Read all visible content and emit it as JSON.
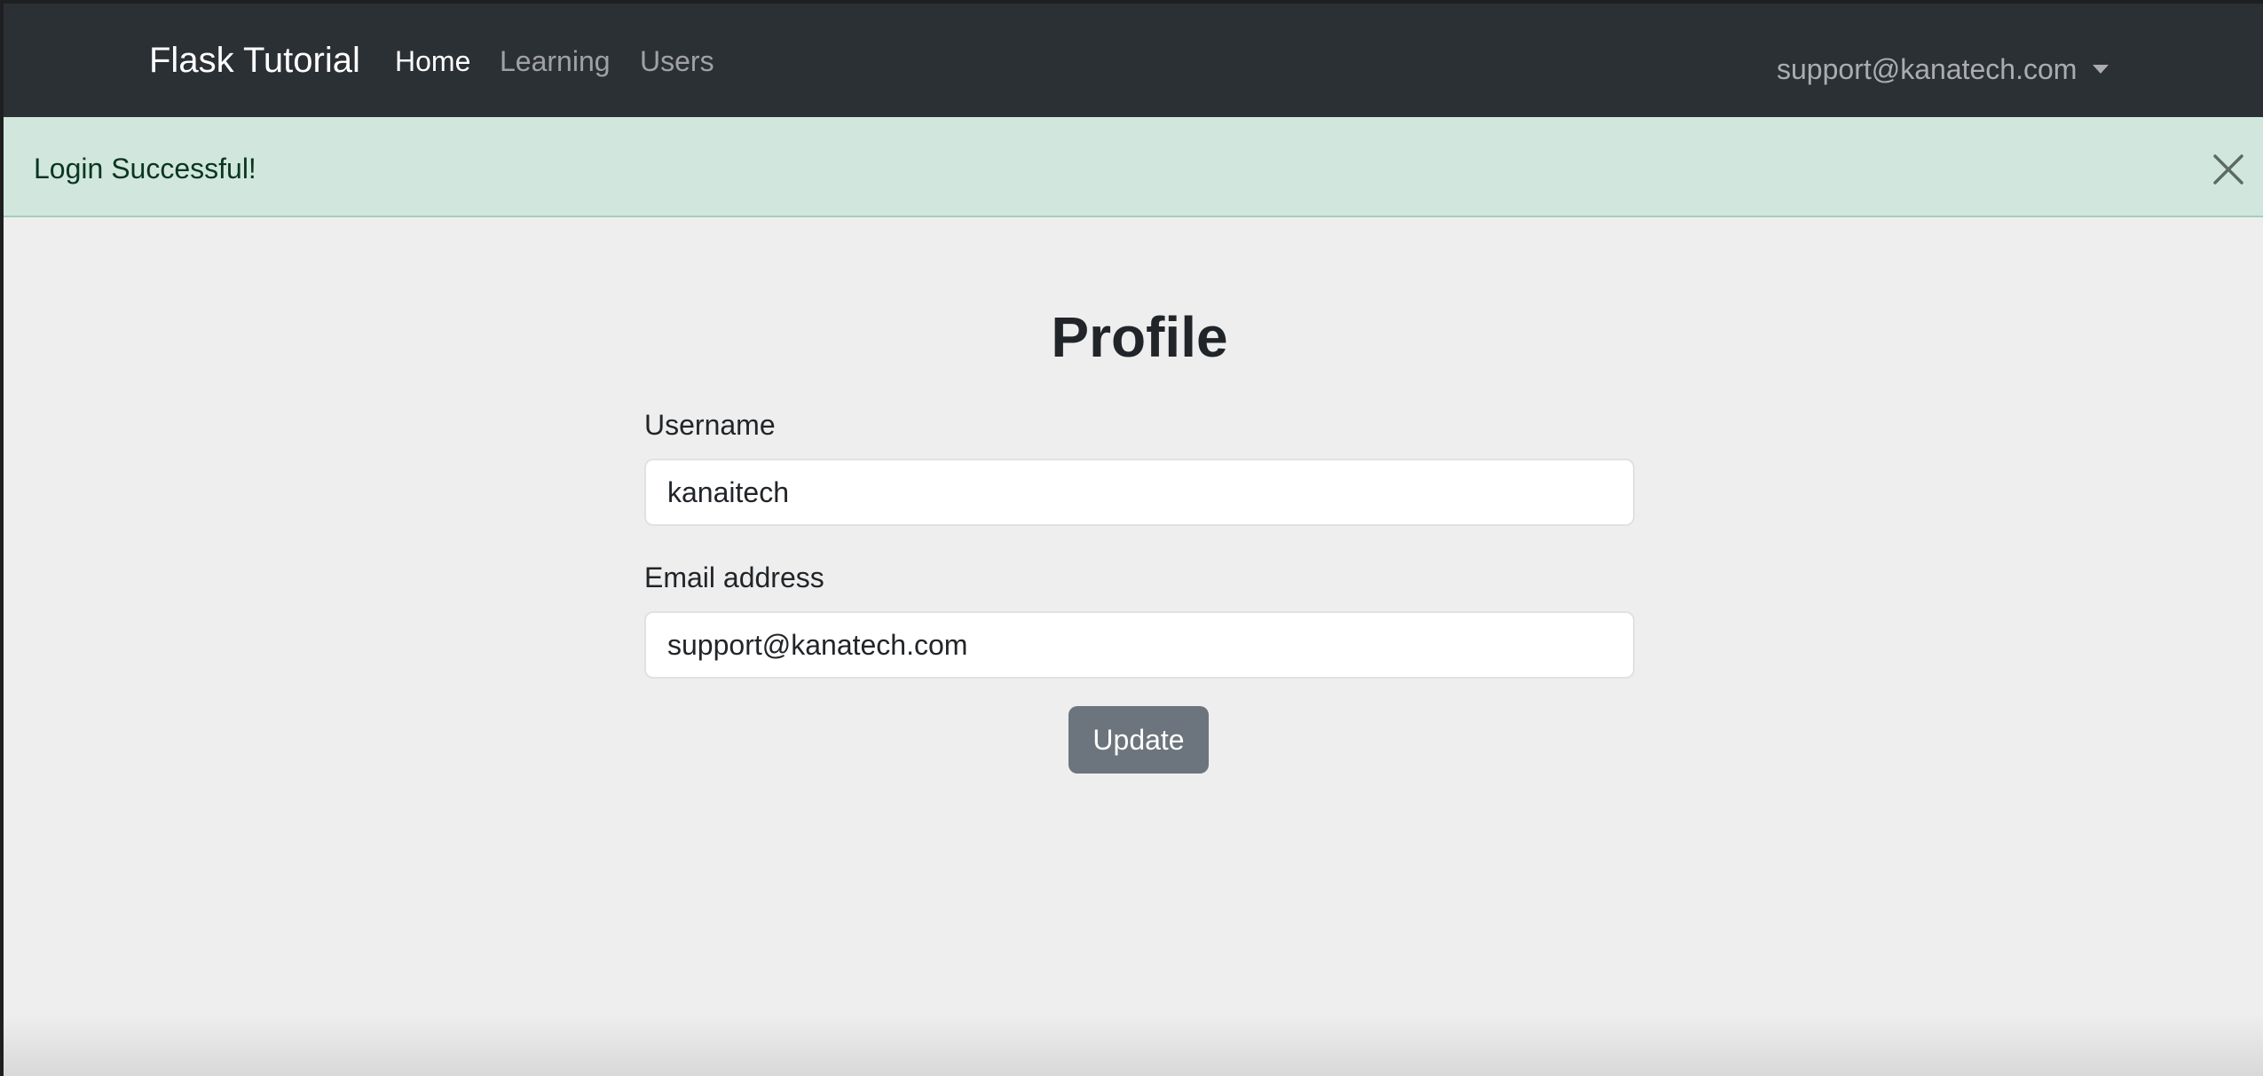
{
  "navbar": {
    "brand": "Flask Tutorial",
    "links": [
      {
        "label": "Home",
        "active": true
      },
      {
        "label": "Learning",
        "active": false
      },
      {
        "label": "Users",
        "active": false
      }
    ],
    "user_menu": {
      "label": "support@kanatech.com",
      "icon": "caret-down-icon"
    }
  },
  "alert": {
    "message": "Login Successful!",
    "close_icon": "close-icon",
    "color": "#d1e7dd"
  },
  "profile": {
    "title": "Profile",
    "username": {
      "label": "Username",
      "value": "kanaitech"
    },
    "email": {
      "label": "Email address",
      "value": "support@kanatech.com"
    },
    "submit_label": "Update"
  },
  "colors": {
    "navbar_bg": "#2b3035",
    "page_bg": "#eeeeee",
    "button_bg": "#6c757d"
  }
}
